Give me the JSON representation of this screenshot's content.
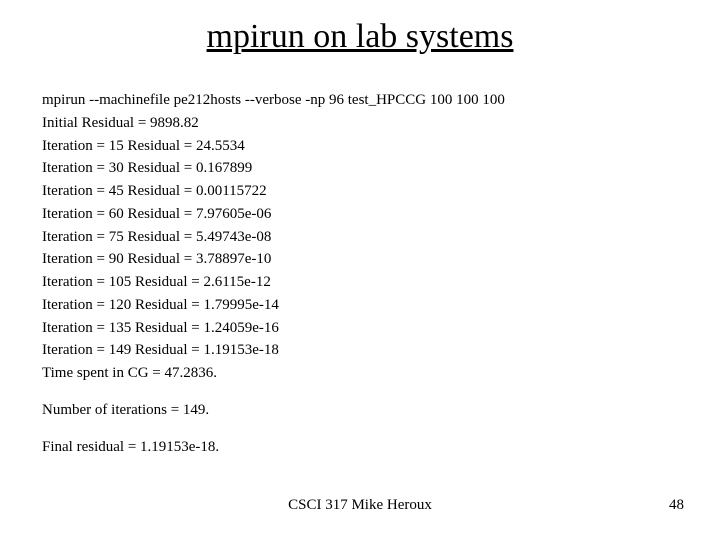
{
  "title": "mpirun on lab systems",
  "lines": {
    "cmd": "mpirun --machinefile pe212hosts --verbose -np 96 test_HPCCG 100 100 100",
    "initial": "Initial Residual = 9898.82",
    "it15": "Iteration = 15   Residual = 24.5534",
    "it30": "Iteration = 30   Residual = 0.167899",
    "it45": "Iteration = 45   Residual = 0.00115722",
    "it60": "Iteration = 60   Residual = 7.97605e-06",
    "it75": "Iteration = 75   Residual = 5.49743e-08",
    "it90": "Iteration = 90   Residual = 3.78897e-10",
    "it105": "Iteration = 105   Residual = 2.6115e-12",
    "it120": "Iteration = 120   Residual = 1.79995e-14",
    "it135": "Iteration = 135   Residual = 1.24059e-16",
    "it149": "Iteration = 149   Residual = 1.19153e-18",
    "time": "Time spent in CG = 47.2836.",
    "numit": "Number of iterations = 149.",
    "final": "Final residual = 1.19153e-18."
  },
  "footer": {
    "center": "CSCI 317 Mike Heroux",
    "page": "48"
  }
}
